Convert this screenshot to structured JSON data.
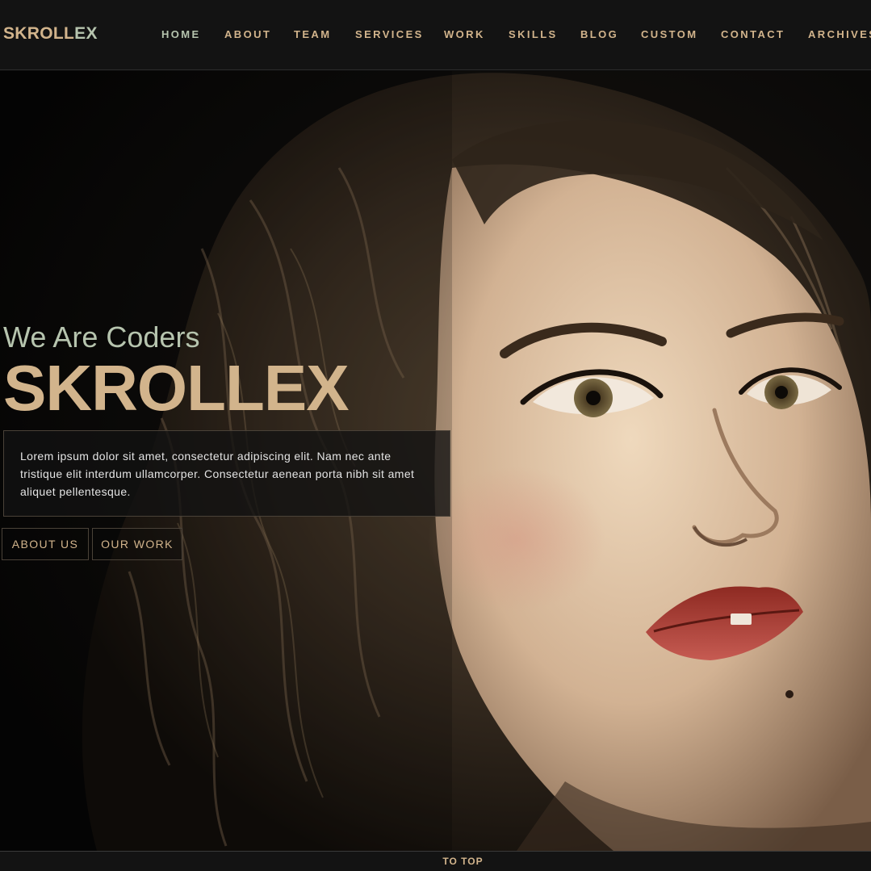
{
  "brand": {
    "part1": "SKROLL",
    "part2": "EX"
  },
  "nav": {
    "items": [
      {
        "label": "HOME",
        "active": true
      },
      {
        "label": "ABOUT"
      },
      {
        "label": "TEAM"
      },
      {
        "label": "SERVICES"
      },
      {
        "label": "WORK"
      },
      {
        "label": "SKILLS"
      },
      {
        "label": "BLOG"
      },
      {
        "label": "CUSTOM"
      },
      {
        "label": "CONTACT"
      },
      {
        "label": "ARCHIVES"
      }
    ]
  },
  "hero": {
    "subtitle": "We Are Coders",
    "title": "SKROLLEX",
    "description": "Lorem ipsum dolor sit amet, consectetur adipiscing elit. Nam nec ante tristique elit interdum ullamcorper. Consectetur aenean porta nibh sit amet aliquet pellentesque.",
    "buttons": {
      "about": "ABOUT US",
      "work": "OUR WORK"
    }
  },
  "footer": {
    "to_top": "TO TOP"
  },
  "colors": {
    "accent_tan": "#d2b48c",
    "accent_sage": "#b6c4ae",
    "header_bg": "#131313"
  }
}
